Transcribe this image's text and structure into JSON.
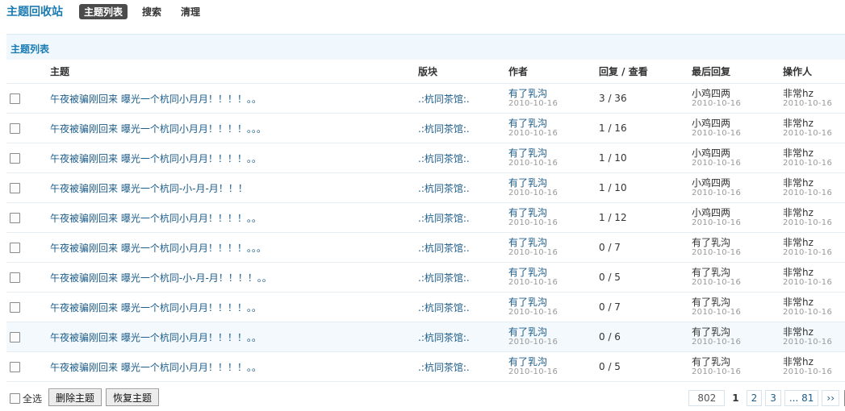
{
  "app_title": "主题回收站",
  "nav": [
    {
      "label": "主题列表",
      "active": true
    },
    {
      "label": "搜索",
      "active": false
    },
    {
      "label": "清理",
      "active": false
    }
  ],
  "section_title": "主题列表",
  "columns": {
    "subject": "主题",
    "forum": "版块",
    "author": "作者",
    "counts": "回复 / 查看",
    "lastpost": "最后回复",
    "operator": "操作人"
  },
  "rows": [
    {
      "subject": "午夜被骗刚回来 曝光一个杭同小月月！！！！。。",
      "forum": ".:杭同茶馆:.",
      "author": "有了乳沟",
      "author_date": "2010-10-16",
      "counts": "3 / 36",
      "last_user": "小鸡四两",
      "last_date": "2010-10-16",
      "operator": "非常hz",
      "op_date": "2010-10-16"
    },
    {
      "subject": "午夜被骗刚回来 曝光一个杭同小月月！！！！。。。",
      "forum": ".:杭同茶馆:.",
      "author": "有了乳沟",
      "author_date": "2010-10-16",
      "counts": "1 / 16",
      "last_user": "小鸡四两",
      "last_date": "2010-10-16",
      "operator": "非常hz",
      "op_date": "2010-10-16"
    },
    {
      "subject": "午夜被骗刚回来 曝光一个杭同小月月！！！！。。",
      "forum": ".:杭同茶馆:.",
      "author": "有了乳沟",
      "author_date": "2010-10-16",
      "counts": "1 / 10",
      "last_user": "小鸡四两",
      "last_date": "2010-10-16",
      "operator": "非常hz",
      "op_date": "2010-10-16"
    },
    {
      "subject": "午夜被骗刚回来 曝光一个杭同-小-月-月！！！",
      "forum": ".:杭同茶馆:.",
      "author": "有了乳沟",
      "author_date": "2010-10-16",
      "counts": "1 / 10",
      "last_user": "小鸡四两",
      "last_date": "2010-10-16",
      "operator": "非常hz",
      "op_date": "2010-10-16"
    },
    {
      "subject": "午夜被骗刚回来 曝光一个杭同小月月！！！！。。",
      "forum": ".:杭同茶馆:.",
      "author": "有了乳沟",
      "author_date": "2010-10-16",
      "counts": "1 / 12",
      "last_user": "小鸡四两",
      "last_date": "2010-10-16",
      "operator": "非常hz",
      "op_date": "2010-10-16"
    },
    {
      "subject": "午夜被骗刚回来 曝光一个杭同小月月！！！！。。。",
      "forum": ".:杭同茶馆:.",
      "author": "有了乳沟",
      "author_date": "2010-10-16",
      "counts": "0 / 7",
      "last_user": "有了乳沟",
      "last_date": "2010-10-16",
      "operator": "非常hz",
      "op_date": "2010-10-16"
    },
    {
      "subject": "午夜被骗刚回来 曝光一个杭同-小-月-月！！！！。。",
      "forum": ".:杭同茶馆:.",
      "author": "有了乳沟",
      "author_date": "2010-10-16",
      "counts": "0 / 5",
      "last_user": "有了乳沟",
      "last_date": "2010-10-16",
      "operator": "非常hz",
      "op_date": "2010-10-16"
    },
    {
      "subject": "午夜被骗刚回来 曝光一个杭同小月月！！！！。。",
      "forum": ".:杭同茶馆:.",
      "author": "有了乳沟",
      "author_date": "2010-10-16",
      "counts": "0 / 7",
      "last_user": "有了乳沟",
      "last_date": "2010-10-16",
      "operator": "非常hz",
      "op_date": "2010-10-16"
    },
    {
      "subject": "午夜被骗刚回来 曝光一个杭同小月月！！！！。。",
      "forum": ".:杭同茶馆:.",
      "author": "有了乳沟",
      "author_date": "2010-10-16",
      "counts": "0 / 6",
      "last_user": "有了乳沟",
      "last_date": "2010-10-16",
      "operator": "非常hz",
      "op_date": "2010-10-16"
    },
    {
      "subject": "午夜被骗刚回来 曝光一个杭同小月月！！！！。。",
      "forum": ".:杭同茶馆:.",
      "author": "有了乳沟",
      "author_date": "2010-10-16",
      "counts": "0 / 5",
      "last_user": "有了乳沟",
      "last_date": "2010-10-16",
      "operator": "非常hz",
      "op_date": "2010-10-16"
    }
  ],
  "footer": {
    "select_all_label": "全选",
    "delete_button": "删除主题",
    "restore_button": "恢复主题"
  },
  "pagination": {
    "total": "802",
    "current": "1",
    "pages": [
      "2",
      "3",
      "... 81"
    ],
    "next": "››"
  },
  "colors": {
    "accent": "#1a7bb3",
    "link": "#1c5c8a",
    "header_bg": "#f0f8fd"
  }
}
